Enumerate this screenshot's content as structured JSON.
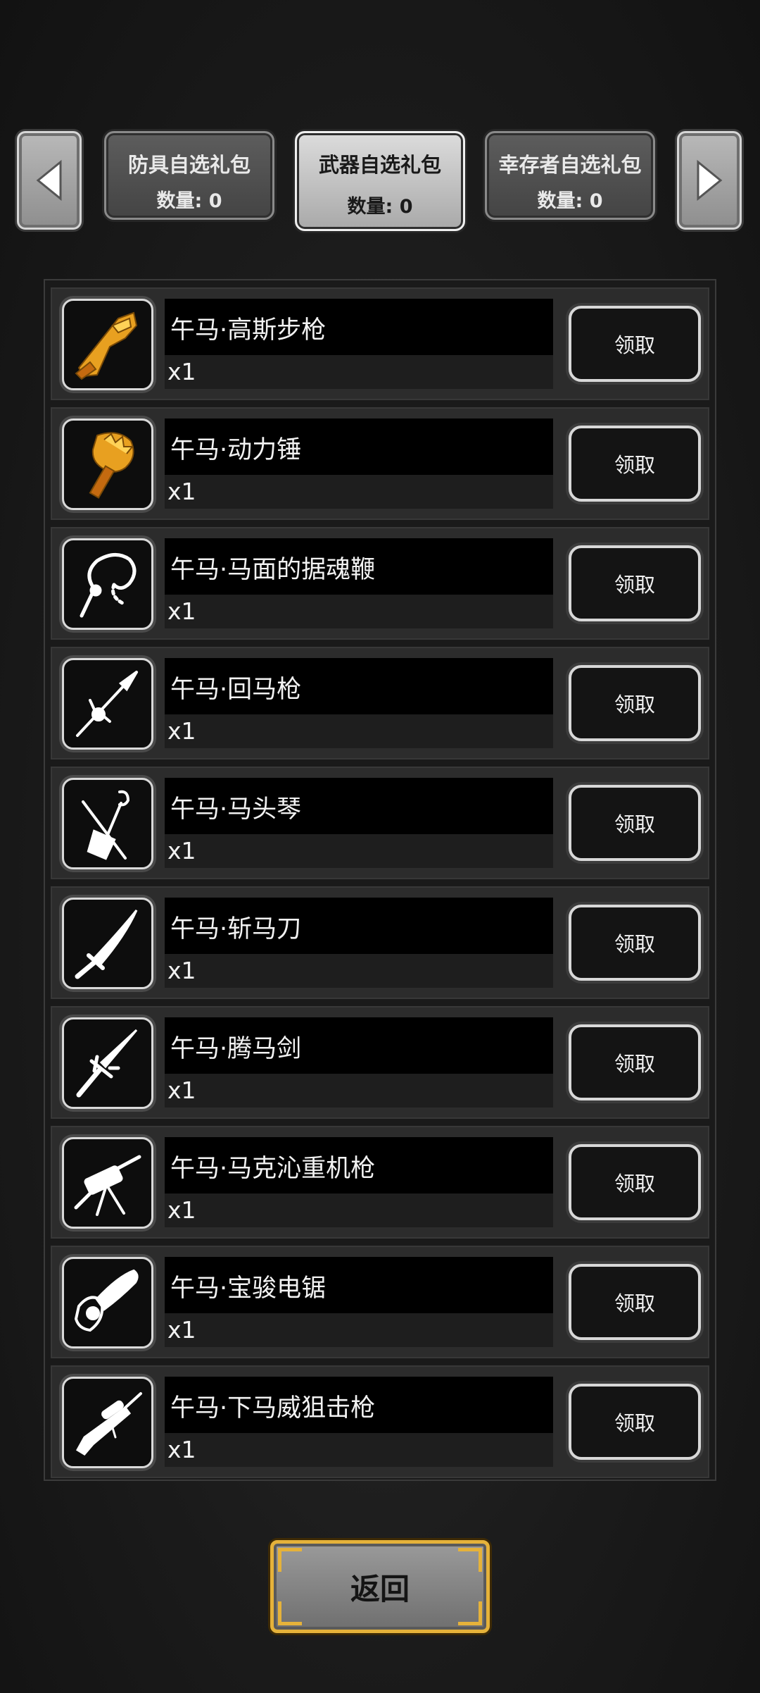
{
  "nav": {
    "prev_icon": "triangle-left-icon",
    "next_icon": "triangle-right-icon",
    "tabs": [
      {
        "label": "防具自选礼包",
        "count": "数量: 0",
        "active": false
      },
      {
        "label": "武器自选礼包",
        "count": "数量: 0",
        "active": true
      },
      {
        "label": "幸存者自选礼包",
        "count": "数量: 0",
        "active": false
      }
    ]
  },
  "items": [
    {
      "name": "午马·高斯步枪",
      "qty": "x1",
      "button": "领取",
      "icon": "gauss-rifle-icon",
      "icon_color": "#e8a020"
    },
    {
      "name": "午马·动力锤",
      "qty": "x1",
      "button": "领取",
      "icon": "power-hammer-icon",
      "icon_color": "#e8a020"
    },
    {
      "name": "午马·马面的据魂鞭",
      "qty": "x1",
      "button": "领取",
      "icon": "whip-icon",
      "icon_color": "#ffffff"
    },
    {
      "name": "午马·回马枪",
      "qty": "x1",
      "button": "领取",
      "icon": "spear-icon",
      "icon_color": "#ffffff"
    },
    {
      "name": "午马·马头琴",
      "qty": "x1",
      "button": "领取",
      "icon": "horsehead-fiddle-icon",
      "icon_color": "#ffffff"
    },
    {
      "name": "午马·斩马刀",
      "qty": "x1",
      "button": "领取",
      "icon": "sabre-icon",
      "icon_color": "#ffffff"
    },
    {
      "name": "午马·腾马剑",
      "qty": "x1",
      "button": "领取",
      "icon": "sword-icon",
      "icon_color": "#ffffff"
    },
    {
      "name": "午马·马克沁重机枪",
      "qty": "x1",
      "button": "领取",
      "icon": "heavy-machine-gun-icon",
      "icon_color": "#ffffff"
    },
    {
      "name": "午马·宝骏电锯",
      "qty": "x1",
      "button": "领取",
      "icon": "chainsaw-icon",
      "icon_color": "#ffffff"
    },
    {
      "name": "午马·下马威狙击枪",
      "qty": "x1",
      "button": "领取",
      "icon": "sniper-rifle-icon",
      "icon_color": "#ffffff"
    }
  ],
  "footer": {
    "back_label": "返回"
  }
}
